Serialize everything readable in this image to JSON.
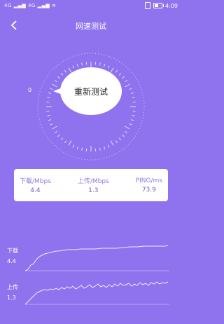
{
  "status_bar": {
    "left_text": "4G ▂▄▆ 4G ▂▄▆ ≋",
    "time": "4:09"
  },
  "header": {
    "title": "网速测试",
    "back_icon": "chevron-left-icon"
  },
  "gauge": {
    "zero_label": "0",
    "button_label": "重新测试"
  },
  "stats": {
    "download_label": "下载/Mbps",
    "download_value": "4.4",
    "upload_label": "上传/Mbps",
    "upload_value": "1.3",
    "ping_label": "PING/ms",
    "ping_value": "73.9"
  },
  "charts": {
    "download": {
      "label": "下载",
      "value": "4.4"
    },
    "upload": {
      "label": "上传",
      "value": "1.3"
    }
  },
  "colors": {
    "background": "#8f73ee",
    "accent": "#6d5cc9"
  }
}
